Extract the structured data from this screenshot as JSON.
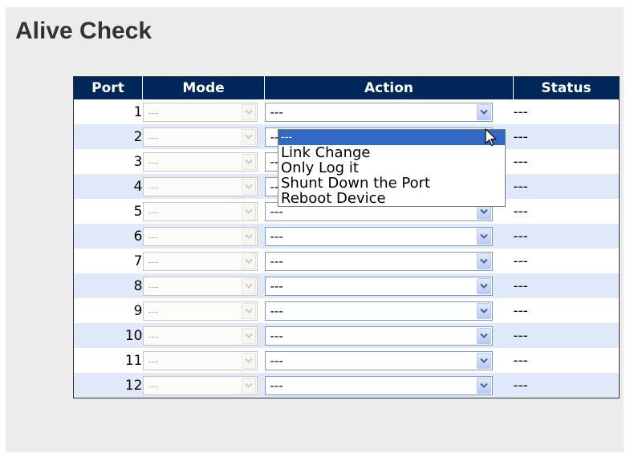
{
  "page": {
    "title": "Alive Check"
  },
  "table": {
    "headers": {
      "port": "Port",
      "mode": "Mode",
      "action": "Action",
      "status": "Status"
    },
    "rows": [
      {
        "port": "1",
        "mode": "---",
        "action": "---",
        "status": "---"
      },
      {
        "port": "2",
        "mode": "---",
        "action": "---",
        "status": "---"
      },
      {
        "port": "3",
        "mode": "---",
        "action": "---",
        "status": "---"
      },
      {
        "port": "4",
        "mode": "---",
        "action": "---",
        "status": "---"
      },
      {
        "port": "5",
        "mode": "---",
        "action": "---",
        "status": "---"
      },
      {
        "port": "6",
        "mode": "---",
        "action": "---",
        "status": "---"
      },
      {
        "port": "7",
        "mode": "---",
        "action": "---",
        "status": "---"
      },
      {
        "port": "8",
        "mode": "---",
        "action": "---",
        "status": "---"
      },
      {
        "port": "9",
        "mode": "---",
        "action": "---",
        "status": "---"
      },
      {
        "port": "10",
        "mode": "---",
        "action": "---",
        "status": "---"
      },
      {
        "port": "11",
        "mode": "---",
        "action": "---",
        "status": "---"
      },
      {
        "port": "12",
        "mode": "---",
        "action": "---",
        "status": "---"
      }
    ]
  },
  "action_dropdown": {
    "options": [
      "---",
      "Link Change",
      "Only Log it",
      "Shunt Down the Port",
      "Reboot Device"
    ],
    "selected": "---"
  },
  "colors": {
    "header_bg": "#00275a",
    "row_alt": "#e0e9fa",
    "highlight": "#316ac5"
  },
  "icons": {
    "select_arrow": "chevron-down-icon",
    "cursor": "mouse-pointer-icon"
  }
}
